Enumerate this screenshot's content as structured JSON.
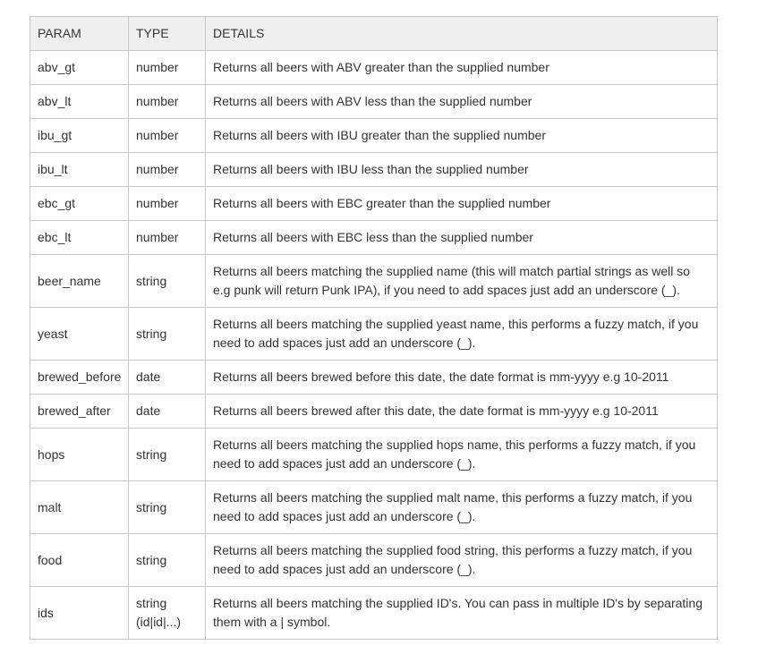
{
  "table": {
    "headers": {
      "param": "PARAM",
      "type": "TYPE",
      "details": "DETAILS"
    },
    "rows": [
      {
        "param": "abv_gt",
        "type": "number",
        "details": "Returns all beers with ABV greater than the supplied number"
      },
      {
        "param": "abv_lt",
        "type": "number",
        "details": "Returns all beers with ABV less than the supplied number"
      },
      {
        "param": "ibu_gt",
        "type": "number",
        "details": "Returns all beers with IBU greater than the supplied number"
      },
      {
        "param": "ibu_lt",
        "type": "number",
        "details": "Returns all beers with IBU less than the supplied number"
      },
      {
        "param": "ebc_gt",
        "type": "number",
        "details": "Returns all beers with EBC greater than the supplied number"
      },
      {
        "param": "ebc_lt",
        "type": "number",
        "details": "Returns all beers with EBC less than the supplied number"
      },
      {
        "param": "beer_name",
        "type": "string",
        "details": "Returns all beers matching the supplied name (this will match partial strings as well so e.g punk will return Punk IPA), if you need to add spaces just add an underscore (_)."
      },
      {
        "param": "yeast",
        "type": "string",
        "details": "Returns all beers matching the supplied yeast name, this performs a fuzzy match, if you need to add spaces just add an underscore (_)."
      },
      {
        "param": "brewed_before",
        "type": "date",
        "details": "Returns all beers brewed before this date, the date format is mm-yyyy e.g 10-2011"
      },
      {
        "param": "brewed_after",
        "type": "date",
        "details": "Returns all beers brewed after this date, the date format is mm-yyyy e.g 10-2011"
      },
      {
        "param": "hops",
        "type": "string",
        "details": "Returns all beers matching the supplied hops name, this performs a fuzzy match, if you need to add spaces just add an underscore (_)."
      },
      {
        "param": "malt",
        "type": "string",
        "details": "Returns all beers matching the supplied malt name, this performs a fuzzy match, if you need to add spaces just add an underscore (_)."
      },
      {
        "param": "food",
        "type": "string",
        "details": "Returns all beers matching the supplied food string, this performs a fuzzy match, if you need to add spaces just add an underscore (_)."
      },
      {
        "param": "ids",
        "type": "string (id|id|...)",
        "details": "Returns all beers matching the supplied ID's. You can pass in multiple ID's by separating them with a | symbol."
      }
    ]
  }
}
